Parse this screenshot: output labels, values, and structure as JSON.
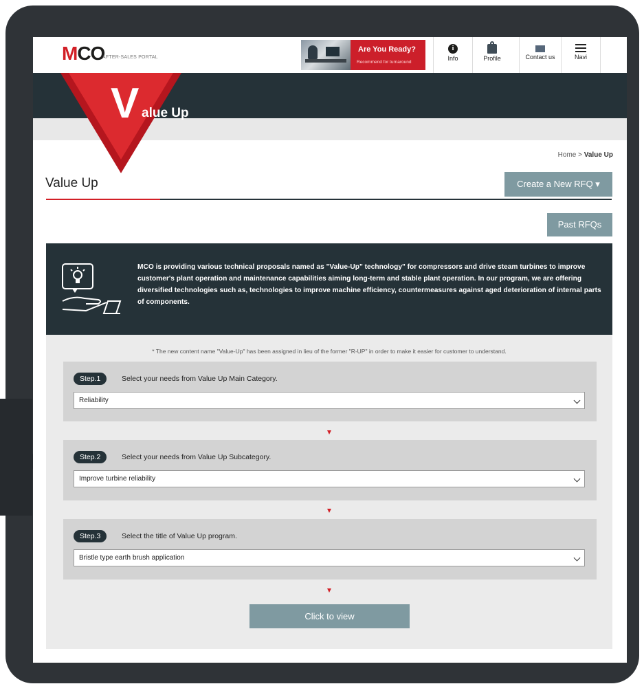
{
  "header": {
    "logo_main": "MCO",
    "logo_sub": "AFTER-SALES PORTAL",
    "banner": {
      "title": "Are You Ready?",
      "subtitle": "Recommend for turnaround"
    },
    "nav": [
      {
        "label": "Info",
        "icon": "info-icon"
      },
      {
        "label": "Profile",
        "icon": "profile-icon"
      },
      {
        "label": "Contact us",
        "icon": "mail-icon"
      },
      {
        "label": "Navi",
        "icon": "menu-icon"
      }
    ]
  },
  "hero": {
    "letter": "V",
    "title": "alue Up"
  },
  "breadcrumb": {
    "home": "Home",
    "separator": ">",
    "current": "Value Up"
  },
  "page": {
    "title": "Value Up",
    "rfq_button": "Create a New RFQ ▾",
    "past_button": "Past RFQs"
  },
  "intro": {
    "icon": "lightbulb-hand-icon",
    "text": "MCO is providing various technical proposals named as \"Value-Up\" technology\" for compressors and drive steam turbines to improve customer's plant operation and maintenance capabilities aiming long-term and stable plant operation. In our program, we are offering diversified technologies such as, technologies to improve machine efficiency, countermeasures against aged deterioration of internal parts of components."
  },
  "note": "* The new content name \"Value-Up\" has been assigned in lieu of the former \"R-UP\" in order to make it easier for customer to understand.",
  "steps": [
    {
      "badge": "Step.1",
      "instruction": "Select your needs from Value Up Main Category.",
      "selected": "Reliability"
    },
    {
      "badge": "Step.2",
      "instruction": "Select your needs from Value Up Subcategory.",
      "selected": "Improve turbine reliability"
    },
    {
      "badge": "Step.3",
      "instruction": "Select the title of Value Up program.",
      "selected": "Bristle type earth brush application"
    }
  ],
  "view_button": "Click to view",
  "colors": {
    "accent_red": "#d21f26",
    "dark": "#253238",
    "button": "#7f9aa1"
  }
}
